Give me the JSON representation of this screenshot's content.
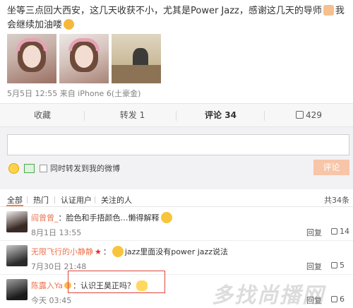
{
  "post": {
    "text_part1": "坐等三点回大西安，这几天收获不小，尤其是Power Jazz，感谢这几天的导师",
    "text_part2": "我会继续加油喽",
    "emoji_icons": [
      "pray-icon",
      "kiss-icon"
    ],
    "meta": "5月5日 12:55 来自 iPhone 6(土豪金)"
  },
  "actions": {
    "favorite": "收藏",
    "repost": "转发 1",
    "comment": "评论 34",
    "like": "429"
  },
  "compose": {
    "textbox_value": "",
    "repost_checkbox_label": "同时转发到我的微博",
    "submit_label": "评论"
  },
  "filters": {
    "all": "全部",
    "hot": "热门",
    "verified": "认证用户",
    "following": "关注的人",
    "total": "共34条"
  },
  "comments": [
    {
      "user": "阎曾曾_",
      "text": "：脸色和手捂颜色…懒得解释",
      "time": "8月1日 13:55",
      "reply": "回复",
      "likes": "14"
    },
    {
      "user": "无限飞行的小静静",
      "text": "jazz里面没有power jazz说法",
      "time": "7月30日 21:48",
      "reply": "回复",
      "likes": "5"
    },
    {
      "user": "陈露入Ya",
      "text": "：认识王昊正吗？",
      "time": "今天 03:45",
      "reply": "回复",
      "likes": "6"
    }
  ],
  "colors": {
    "accent": "#eb7350",
    "submit_disabled": "#f7c5a8",
    "highlight_box": "#e0463a"
  }
}
